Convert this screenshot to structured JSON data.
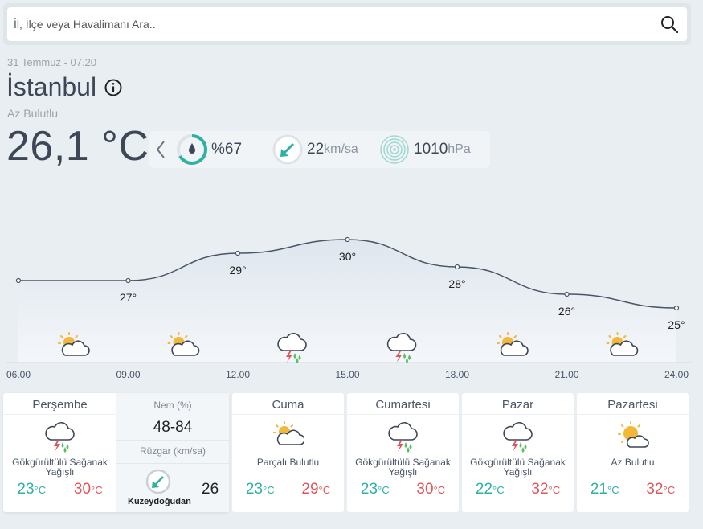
{
  "search": {
    "placeholder": "İl, İlçe veya Havalimanı Ara.."
  },
  "current": {
    "date": "31 Temmuz - 07.20",
    "city": "İstanbul",
    "condition": "Az Bulutlu",
    "temperature": "26,1 °C",
    "humidity": {
      "value": "%67",
      "percent": 67
    },
    "wind": {
      "value": "22",
      "unit": "km/sa"
    },
    "pressure": {
      "value": "1010",
      "unit": "hPa"
    }
  },
  "chart_data": {
    "type": "line",
    "x": [
      "06.00",
      "09.00",
      "12.00",
      "15.00",
      "18.00",
      "21.00",
      "24.00"
    ],
    "series": [
      {
        "values": [
          27,
          27,
          29,
          30,
          28,
          26,
          25
        ],
        "labels": [
          "",
          "27°",
          "29°",
          "30°",
          "28°",
          "26°",
          "25°"
        ]
      }
    ],
    "icons": [
      "partly-cloudy-icon",
      "partly-cloudy-icon",
      "thunderstorm-rain-icon",
      "thunderstorm-rain-icon",
      "partly-cloudy-icon",
      "partly-cloudy-icon",
      "partly-cloudy-icon"
    ],
    "ylim": [
      24,
      31
    ],
    "grid": false
  },
  "forecast": {
    "first": {
      "day": "Perşembe",
      "condition": "Gökgürültülü Sağanak Yağışlı",
      "icon": "thunderstorm-rain-icon",
      "min": "23",
      "max": "30",
      "humidity_label": "Nem (%)",
      "humidity": "48-84",
      "wind_label": "Rüzgar (km/sa)",
      "wind_dir": "Kuzeydoğudan",
      "wind_speed": "26"
    },
    "days": [
      {
        "day": "Cuma",
        "condition": "Parçalı Bulutlu",
        "icon": "partly-cloudy-icon",
        "min": "23",
        "max": "29"
      },
      {
        "day": "Cumartesi",
        "condition": "Gökgürültülü Sağanak Yağışlı",
        "icon": "thunderstorm-rain-icon",
        "min": "23",
        "max": "30"
      },
      {
        "day": "Pazar",
        "condition": "Gökgürültülü Sağanak Yağışlı",
        "icon": "thunderstorm-rain-icon",
        "min": "22",
        "max": "32"
      },
      {
        "day": "Pazartesi",
        "condition": "Az Bulutlu",
        "icon": "mostly-sunny-icon",
        "min": "21",
        "max": "32"
      }
    ],
    "unit": "°C"
  },
  "colors": {
    "accent": "#2fb0a4",
    "min_temp": "#2fb0a4",
    "max_temp": "#e0555b",
    "text": "#3d4756"
  }
}
